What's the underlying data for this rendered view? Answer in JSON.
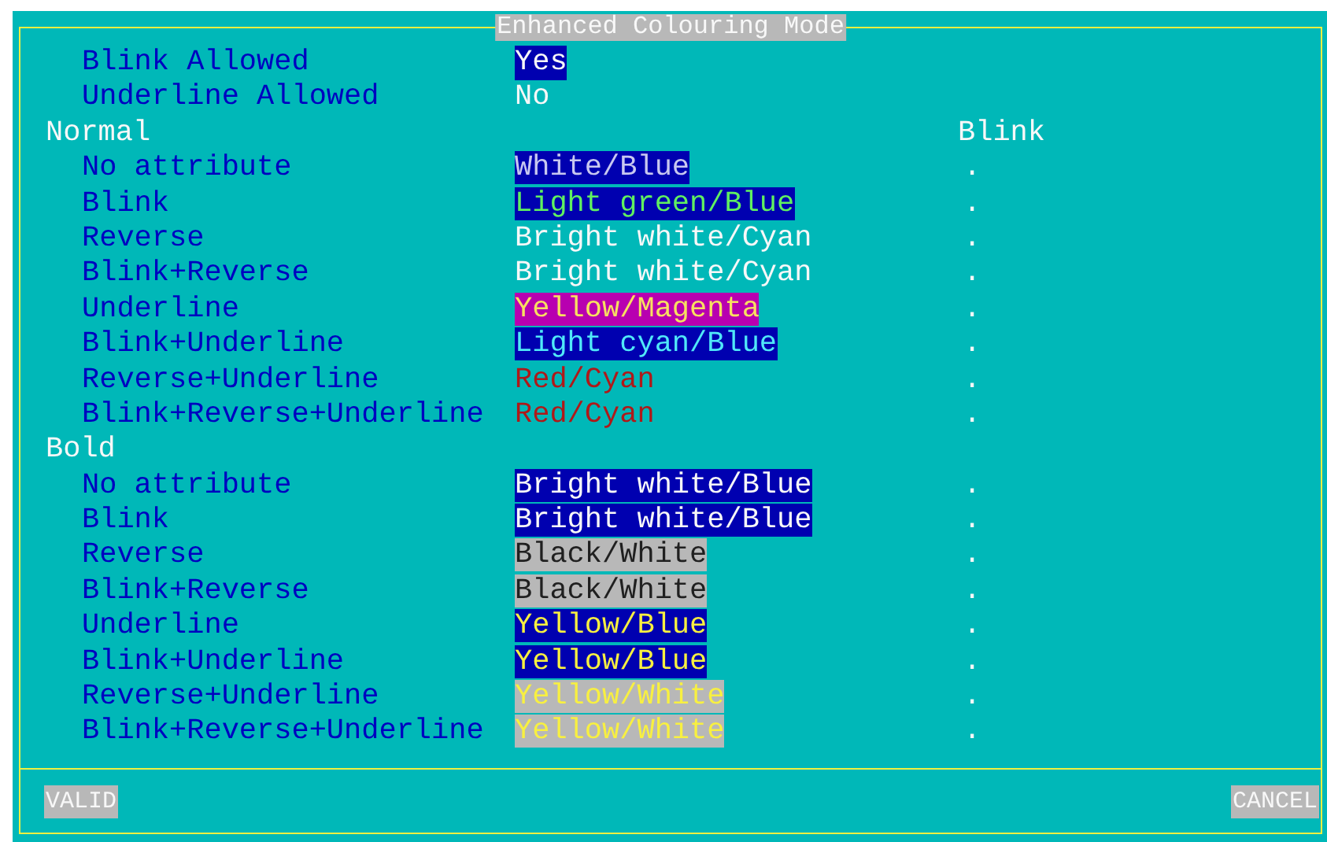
{
  "window": {
    "title": "Enhanced Colouring Mode"
  },
  "options": [
    {
      "label": "Blink Allowed",
      "value": "Yes",
      "selected": true
    },
    {
      "label": "Underline Allowed",
      "value": "No",
      "selected": false
    }
  ],
  "blink_header": "Blink",
  "sections": [
    {
      "title": "Normal",
      "rows": [
        {
          "label": "No attribute",
          "value": "White/Blue",
          "kind": "white-on-blue",
          "blink": "."
        },
        {
          "label": "Blink",
          "value": "Light green/Blue",
          "kind": "lightgreen-on-blue",
          "blink": "."
        },
        {
          "label": "Reverse",
          "value": "Bright white/Cyan",
          "kind": "brightwhite-on-cyan",
          "blink": "."
        },
        {
          "label": "Blink+Reverse",
          "value": "Bright white/Cyan",
          "kind": "brightwhite-on-cyan",
          "blink": "."
        },
        {
          "label": "Underline",
          "value": "Yellow/Magenta",
          "kind": "yellow-on-magenta",
          "blink": "."
        },
        {
          "label": "Blink+Underline",
          "value": "Light cyan/Blue",
          "kind": "lightcyan-on-blue",
          "blink": "."
        },
        {
          "label": "Reverse+Underline",
          "value": "Red/Cyan",
          "kind": "red-on-cyan",
          "blink": "."
        },
        {
          "label": "Blink+Reverse+Underline",
          "value": "Red/Cyan",
          "kind": "red-on-cyan",
          "blink": "."
        }
      ]
    },
    {
      "title": "Bold",
      "rows": [
        {
          "label": "No attribute",
          "value": "Bright white/Blue",
          "kind": "brightwhite-on-blue",
          "blink": "."
        },
        {
          "label": "Blink",
          "value": "Bright white/Blue",
          "kind": "brightwhite-on-blue",
          "blink": "."
        },
        {
          "label": "Reverse",
          "value": "Black/White",
          "kind": "black-on-white",
          "blink": "."
        },
        {
          "label": "Blink+Reverse",
          "value": "Black/White",
          "kind": "black-on-white",
          "blink": "."
        },
        {
          "label": "Underline",
          "value": "Yellow/Blue",
          "kind": "yellow-on-blue",
          "blink": "."
        },
        {
          "label": "Blink+Underline",
          "value": "Yellow/Blue",
          "kind": "yellow-on-blue",
          "blink": "."
        },
        {
          "label": "Reverse+Underline",
          "value": "Yellow/White",
          "kind": "yellow-on-white",
          "blink": "."
        },
        {
          "label": "Blink+Reverse+Underline",
          "value": "Yellow/White",
          "kind": "yellow-on-white",
          "blink": "."
        }
      ]
    }
  ],
  "buttons": [
    {
      "label": "VALID"
    },
    {
      "label": "CANCEL"
    }
  ]
}
